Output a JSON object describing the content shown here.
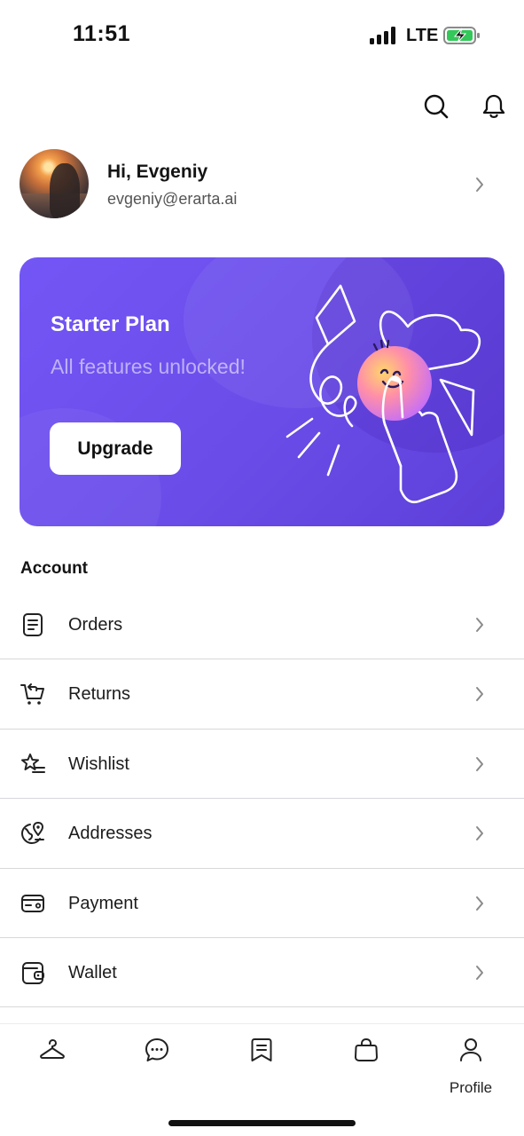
{
  "status_bar": {
    "time": "11:51",
    "network": "LTE",
    "icons": [
      "signal-icon",
      "battery-charging-icon"
    ]
  },
  "header": {
    "icons": [
      "search-icon",
      "bell-icon"
    ]
  },
  "profile": {
    "greeting": "Hi, Evgeniy",
    "email": "evgeniy@erarta.ai"
  },
  "plan_card": {
    "title": "Starter Plan",
    "subtitle": "All features unlocked!",
    "button_label": "Upgrade",
    "accent_color": "#6a4ce8"
  },
  "account": {
    "section_title": "Account",
    "items": [
      {
        "label": "Orders",
        "icon": "receipt-icon"
      },
      {
        "label": "Returns",
        "icon": "cart-return-icon"
      },
      {
        "label": "Wishlist",
        "icon": "star-list-icon"
      },
      {
        "label": "Addresses",
        "icon": "map-pin-icon"
      },
      {
        "label": "Payment",
        "icon": "card-icon"
      },
      {
        "label": "Wallet",
        "icon": "wallet-icon"
      }
    ]
  },
  "bottom_nav": {
    "items": [
      {
        "icon": "hanger-icon"
      },
      {
        "icon": "chat-icon"
      },
      {
        "icon": "bookmark-icon"
      },
      {
        "icon": "bag-icon"
      },
      {
        "icon": "user-icon",
        "label": "Profile",
        "active": true
      }
    ]
  }
}
